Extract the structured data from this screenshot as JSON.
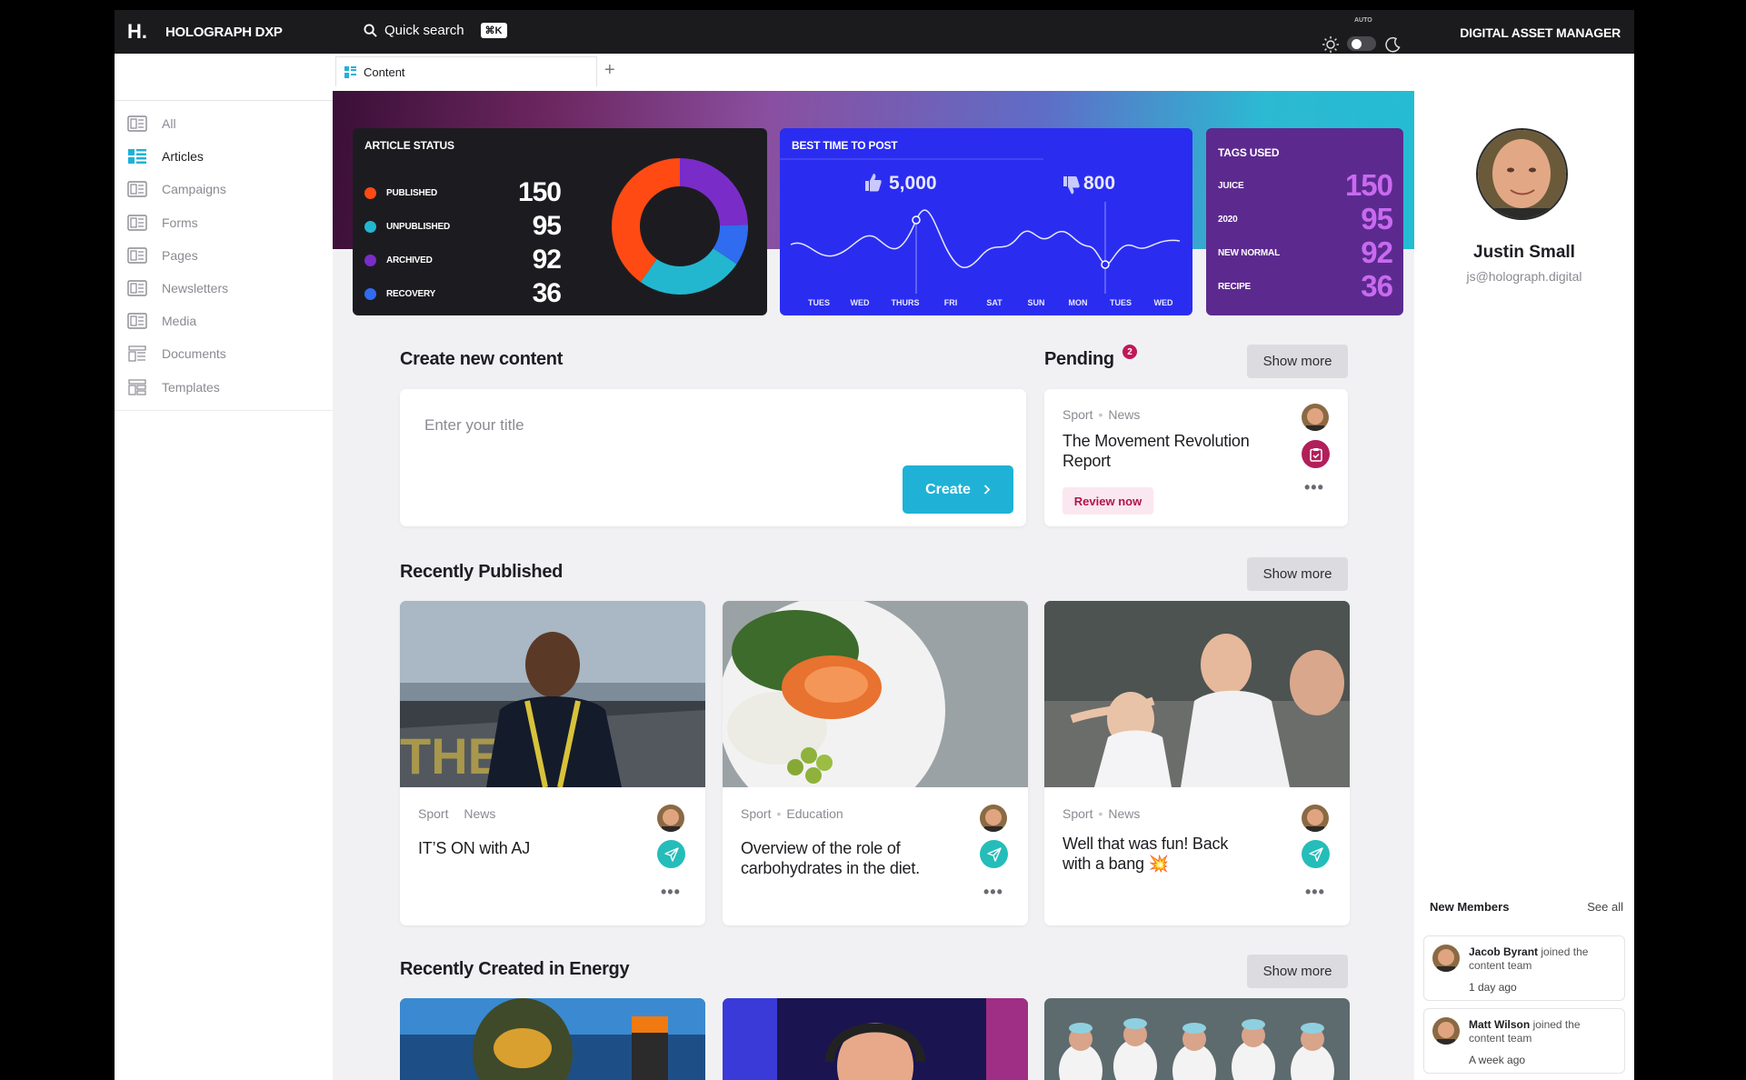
{
  "app": {
    "logo": "H.",
    "brand": "HOLOGRAPH DXP",
    "search_label": "Quick search",
    "search_shortcut": "⌘K",
    "theme_auto_label": "AUTO",
    "product_title": "DIGITAL ASSET MANAGER"
  },
  "tabs": [
    {
      "label": "Content",
      "icon": "content-grid-icon"
    }
  ],
  "sidebar": {
    "items": [
      {
        "label": "All",
        "icon": "list-box-icon",
        "active": false
      },
      {
        "label": "Articles",
        "icon": "articles-icon",
        "active": true
      },
      {
        "label": "Campaigns",
        "icon": "list-box-icon",
        "active": false
      },
      {
        "label": "Forms",
        "icon": "list-box-icon",
        "active": false
      },
      {
        "label": "Pages",
        "icon": "list-box-icon",
        "active": false
      },
      {
        "label": "Newsletters",
        "icon": "list-box-icon",
        "active": false
      },
      {
        "label": "Media",
        "icon": "list-box-icon",
        "active": false
      },
      {
        "label": "Documents",
        "icon": "documents-icon",
        "active": false
      },
      {
        "label": "Templates",
        "icon": "templates-icon",
        "active": false
      }
    ]
  },
  "article_status": {
    "title": "ARTICLE STATUS",
    "rows": [
      {
        "label": "PUBLISHED",
        "value": 150,
        "color": "#ff4a14"
      },
      {
        "label": "UNPUBLISHED",
        "value": 95,
        "color": "#23b7cf"
      },
      {
        "label": "ARCHIVED",
        "value": 92,
        "color": "#7a2cc9"
      },
      {
        "label": "RECOVERY",
        "value": 36,
        "color": "#2f6cf0"
      }
    ]
  },
  "best_time": {
    "title": "BEST TIME TO POST",
    "likes": "5,000",
    "dislikes": "800",
    "days": [
      "TUES",
      "WED",
      "THURS",
      "FRI",
      "SAT",
      "SUN",
      "MON",
      "TUES",
      "WED"
    ]
  },
  "tags_used": {
    "title": "TAGS USED",
    "rows": [
      {
        "label": "JUICE",
        "value": 150
      },
      {
        "label": "2020",
        "value": 95
      },
      {
        "label": "NEW NORMAL",
        "value": 92
      },
      {
        "label": "RECIPE",
        "value": 36
      }
    ]
  },
  "create": {
    "heading": "Create new content",
    "placeholder": "Enter your title",
    "button": "Create"
  },
  "pending": {
    "heading": "Pending",
    "count": "2",
    "show_more": "Show more",
    "item": {
      "category": "Sport",
      "tag": "News",
      "title": "The Movement Revolution Report",
      "action": "Review now"
    }
  },
  "recently_published": {
    "heading": "Recently Published",
    "show_more": "Show more",
    "cards": [
      {
        "category": "Sport",
        "tag": "News",
        "title": "IT’S ON with AJ"
      },
      {
        "category": "Sport",
        "tag": "Education",
        "title": "Overview of the role of carbohydrates in the diet."
      },
      {
        "category": "Sport",
        "tag": "News",
        "title": "Well that was fun! Back with a bang 💥"
      }
    ]
  },
  "recently_created": {
    "heading": "Recently Created in Energy",
    "show_more": "Show more"
  },
  "profile": {
    "name": "Justin Small",
    "email": "js@holograph.digital"
  },
  "new_members": {
    "title": "New Members",
    "see_all": "See all",
    "items": [
      {
        "name": "Jacob Byrant",
        "text": "joined the content team",
        "time": "1 day ago"
      },
      {
        "name": "Matt Wilson",
        "text": "joined the content team",
        "time": "A week ago"
      }
    ]
  },
  "colors": {
    "accent_cyan": "#1fb2d6",
    "pending_red": "#c0185a",
    "best_time_blue": "#2a2df0",
    "tags_purple": "#5c2a8e",
    "tags_number": "#c86af0"
  }
}
